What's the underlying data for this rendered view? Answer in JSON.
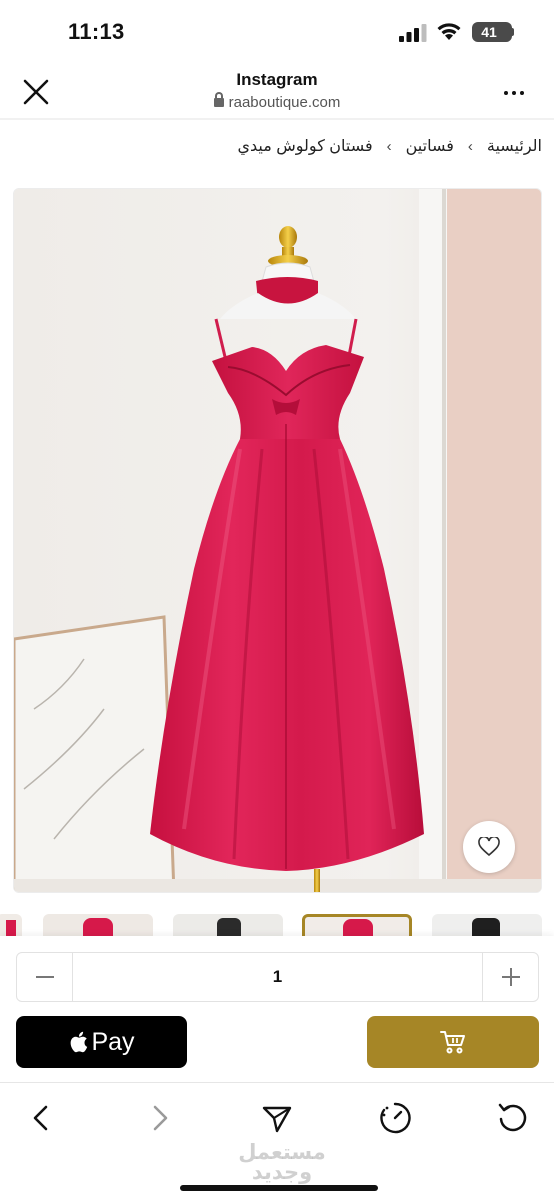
{
  "status_bar": {
    "time": "11:13",
    "battery": "41"
  },
  "header": {
    "title": "Instagram",
    "url": "raaboutique.com"
  },
  "breadcrumb": {
    "items": [
      "الرئيسية",
      "فساتين",
      "فستان كولوش ميدي"
    ],
    "separator": "›"
  },
  "product": {
    "image_icon": "red-midi-dress-photo",
    "favorite_icon": "heart-icon"
  },
  "quantity": {
    "value": "1",
    "minus_icon": "minus-icon",
    "plus_icon": "plus-icon"
  },
  "buttons": {
    "apple_pay_label": "Pay",
    "cart_icon": "cart-icon"
  },
  "colors": {
    "accent": "#a68626",
    "dress": "#d6194a"
  },
  "watermark": {
    "line1": "مستعمل",
    "line2": "وجديد"
  }
}
